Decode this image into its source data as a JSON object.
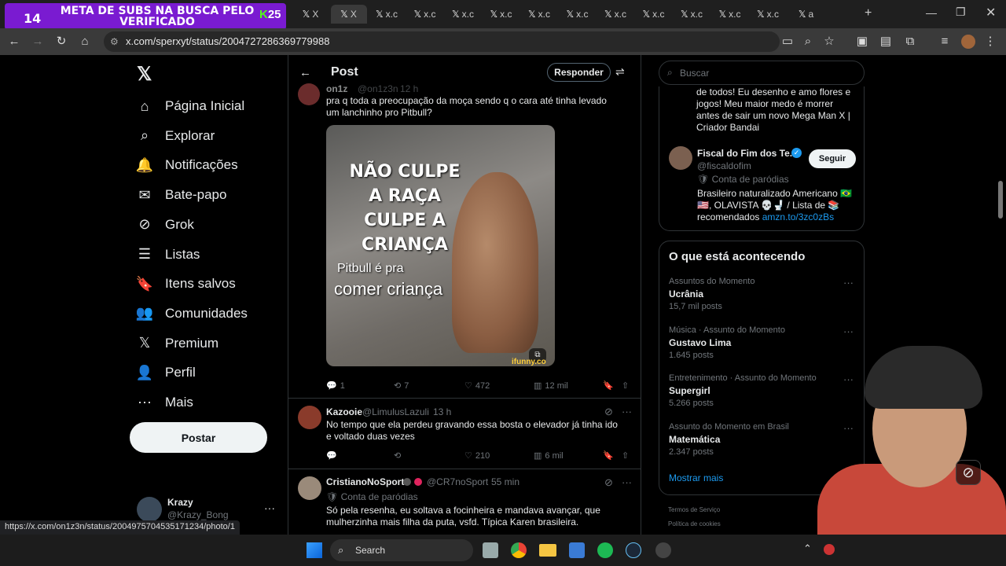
{
  "overlay": {
    "count": "14",
    "banner_text": "META DE SUBS NA BUSCA PELO VERIFICADO",
    "badge": "25"
  },
  "browser": {
    "tabs": [
      {
        "label": "X",
        "active": false
      },
      {
        "label": "X",
        "active": true
      },
      {
        "label": "x.c",
        "active": false
      },
      {
        "label": "x.c",
        "active": false
      },
      {
        "label": "x.c",
        "active": false
      },
      {
        "label": "x.c",
        "active": false
      },
      {
        "label": "x.c",
        "active": false
      },
      {
        "label": "x.c",
        "active": false
      },
      {
        "label": "x.c",
        "active": false
      },
      {
        "label": "x.c",
        "active": false
      },
      {
        "label": "x.c",
        "active": false
      },
      {
        "label": "x.c",
        "active": false
      },
      {
        "label": "x.c",
        "active": false
      },
      {
        "label": "a",
        "active": false
      }
    ],
    "url": "x.com/sperxyt/status/2004727286369779988",
    "status_url": "https://x.com/on1z3n/status/2004975704535171234/photo/1"
  },
  "sidebar": {
    "items": [
      {
        "label": "Página Inicial",
        "icon": "home-icon"
      },
      {
        "label": "Explorar",
        "icon": "search-icon"
      },
      {
        "label": "Notificações",
        "icon": "bell-icon"
      },
      {
        "label": "Bate-papo",
        "icon": "mail-icon"
      },
      {
        "label": "Grok",
        "icon": "grok-icon"
      },
      {
        "label": "Listas",
        "icon": "list-icon"
      },
      {
        "label": "Itens salvos",
        "icon": "bookmark-icon"
      },
      {
        "label": "Comunidades",
        "icon": "people-icon"
      },
      {
        "label": "Premium",
        "icon": "x-logo-icon"
      },
      {
        "label": "Perfil",
        "icon": "person-icon"
      },
      {
        "label": "Mais",
        "icon": "more-circle-icon"
      }
    ],
    "post_label": "Postar",
    "account": {
      "name": "Krazy",
      "handle": "@Krazy_Bong"
    }
  },
  "header": {
    "title": "Post",
    "reply_label": "Responder"
  },
  "tweets": [
    {
      "name": "on1z",
      "handle": "@on1z3n",
      "time": "12 h",
      "text": "pra q toda a preocupação da moça sendo q o cara até tinha levado um lanchinho pro Pitbull?",
      "image_text": {
        "line1": "NÃO CULPE",
        "line2": "A RAÇA",
        "line3": "CULPE A",
        "line4": "CRIANÇA",
        "line5": "Pitbull é pra",
        "line6": "comer criança",
        "watermark": "ifunny.co"
      },
      "stats": {
        "replies": "1",
        "reposts": "7",
        "likes": "472",
        "views": "12 mil"
      }
    },
    {
      "name": "Kazooie",
      "handle": "@LimulusLazuli",
      "time": "13 h",
      "text": "No tempo que ela perdeu gravando essa bosta o elevador já tinha ido e voltado duas vezes",
      "stats": {
        "replies": "",
        "reposts": "",
        "likes": "210",
        "views": "6 mil"
      }
    },
    {
      "name": "CristianoNoSport",
      "handle": "@CR7noSport",
      "time": "55 min",
      "label": "Conta de paródias",
      "text": "Só pela resenha, eu soltava a focinheira e mandava avançar, que mulherzinha mais filha da puta, vsfd. Típica Karen brasileira."
    }
  ],
  "right": {
    "search_placeholder": "Buscar",
    "bio_top": "de todos! Eu desenho e amo flores e jogos! Meu maior medo é morrer antes de sair um novo Mega Man X | Criador Bandai",
    "suggest": {
      "name": "Fiscal do Fim dos Te...",
      "handle": "@fiscaldofim",
      "label": "Conta de paródias",
      "bio": "Brasileiro naturalizado Americano 🇧🇷🇺🇸, OLAVISTA 💀🚽 / Lista de 📚 recomendados",
      "link": "amzn.to/3zc0zBs",
      "follow_label": "Seguir"
    },
    "trends_title": "O que está acontecendo",
    "trends": [
      {
        "category": "Assuntos do Momento",
        "name": "Ucrânia",
        "count": "15,7 mil posts"
      },
      {
        "category": "Música · Assunto do Momento",
        "name": "Gustavo Lima",
        "count": "1.645 posts"
      },
      {
        "category": "Entretenimento · Assunto do Momento",
        "name": "Supergirl",
        "count": "5.266 posts"
      },
      {
        "category": "Assunto do Momento em Brasil",
        "name": "Matemática",
        "count": "2.347 posts"
      }
    ],
    "show_more": "Mostrar mais",
    "footer1": "Termos de Serviço",
    "footer2": "Política de cookies"
  },
  "taskbar": {
    "search_label": "Search"
  },
  "colors": {
    "accent": "#1d9bf0",
    "overlay": "#7a1bd1",
    "verified": "#1d9bf0"
  }
}
